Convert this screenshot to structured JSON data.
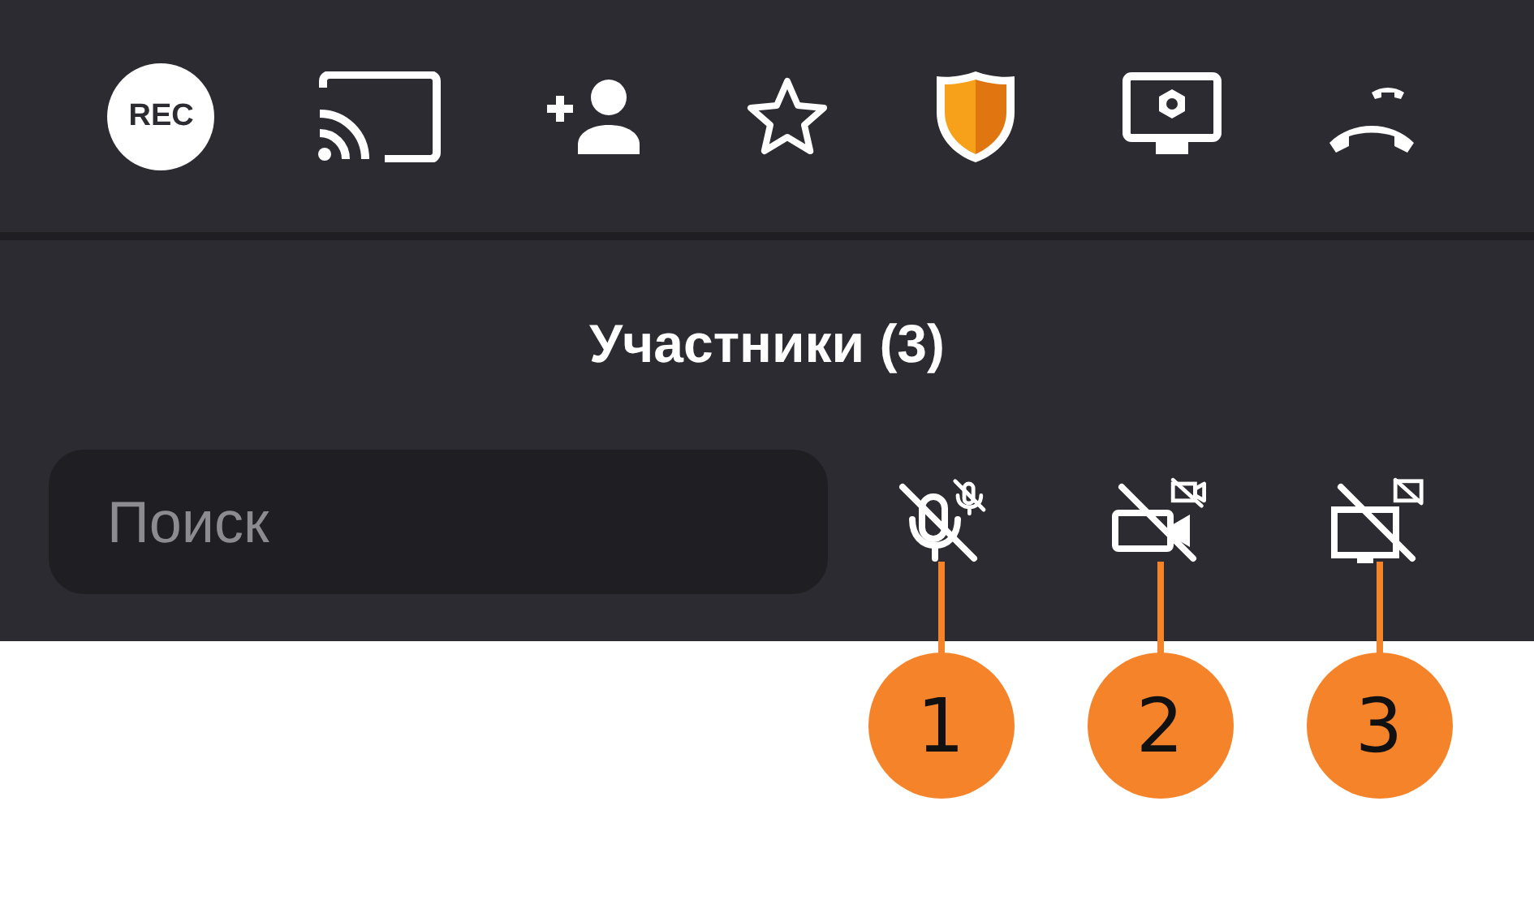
{
  "toolbar": [
    {
      "kind": "rec",
      "label": "REC"
    },
    {
      "kind": "cast"
    },
    {
      "kind": "add-user"
    },
    {
      "kind": "star"
    },
    {
      "kind": "shield"
    },
    {
      "kind": "screen-settings"
    },
    {
      "kind": "hangup"
    }
  ],
  "panel": {
    "title": "Участники (3)",
    "search": {
      "placeholder": "Поиск"
    },
    "controls": [
      {
        "kind": "mic",
        "callout": "1"
      },
      {
        "kind": "camera",
        "callout": "2"
      },
      {
        "kind": "screen",
        "callout": "3"
      }
    ]
  }
}
